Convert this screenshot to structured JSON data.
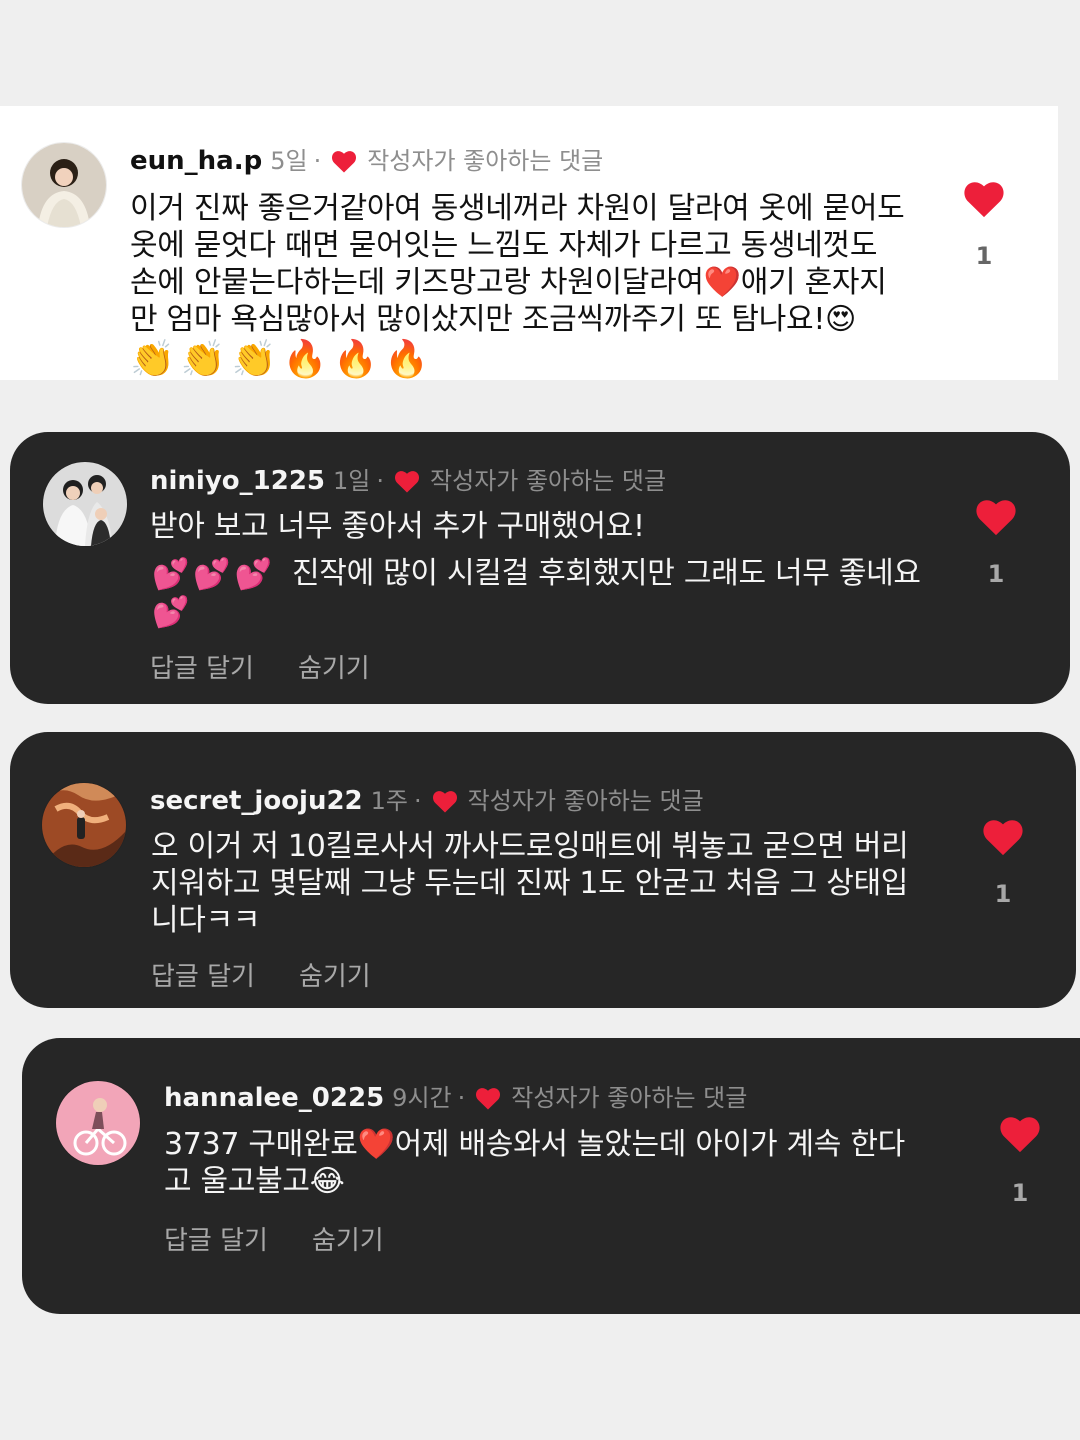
{
  "comments": [
    {
      "username": "eun_ha.p",
      "time": "5일",
      "separator": "·",
      "liked_label": "작성자가 좋아하는 댓글",
      "text": "이거 진짜 좋은거같아여 동생네꺼라 차원이 달라여 옷에 묻어도\n옷에 묻엇다 때면 묻어잇는 느낌도 자체가 다르고 동생네껏도\n손에 안뭍는다하는데 키즈망고랑 차원이달라여❤️애기 혼자지\n만 엄마 욕심많아서 많이샀지만 조금씩까주기 또 탐나요!😍",
      "emoji_line": "👏👏👏🔥🔥🔥",
      "likes": "1",
      "avatar": "avatar-woman-dress",
      "heart_color": "#ed1f3a"
    },
    {
      "username": "niniyo_1225",
      "time": "1일",
      "separator": "·",
      "liked_label": "작성자가 좋아하는 댓글",
      "text": "받아 보고 너무 좋아서 추가 구매했어요!",
      "emoji_prefix": "💕💕💕",
      "text2": "진작에 많이 시킬걸 후회했지만 그래도 너무 좋네요",
      "emoji_suffix": "💕",
      "likes": "1",
      "avatar": "avatar-family",
      "reply": "답글 달기",
      "hide": "숨기기",
      "heart_color": "#ed1f3a"
    },
    {
      "username": "secret_jooju22",
      "time": "1주",
      "separator": "·",
      "liked_label": "작성자가 좋아하는 댓글",
      "text": "오 이거 저 10킬로사서 까사드로잉매트에 붜놓고 굳으면 버리\n지워하고 몇달째 그냥 두는데 진짜 1도 안굳고 처음 그 상태입\n니다ㅋㅋ",
      "likes": "1",
      "avatar": "avatar-canyon",
      "reply": "답글 달기",
      "hide": "숨기기",
      "heart_color": "#ed1f3a"
    },
    {
      "username": "hannalee_0225",
      "time": "9시간",
      "separator": "·",
      "liked_label": "작성자가 좋아하는 댓글",
      "text": "3737 구매완료❤️어제 배송와서 놀았는데 아이가 계속 한다\n고 울고불고😂",
      "likes": "1",
      "avatar": "avatar-bicycle",
      "reply": "답글 달기",
      "hide": "숨기기",
      "heart_color": "#ed1f3a"
    }
  ]
}
